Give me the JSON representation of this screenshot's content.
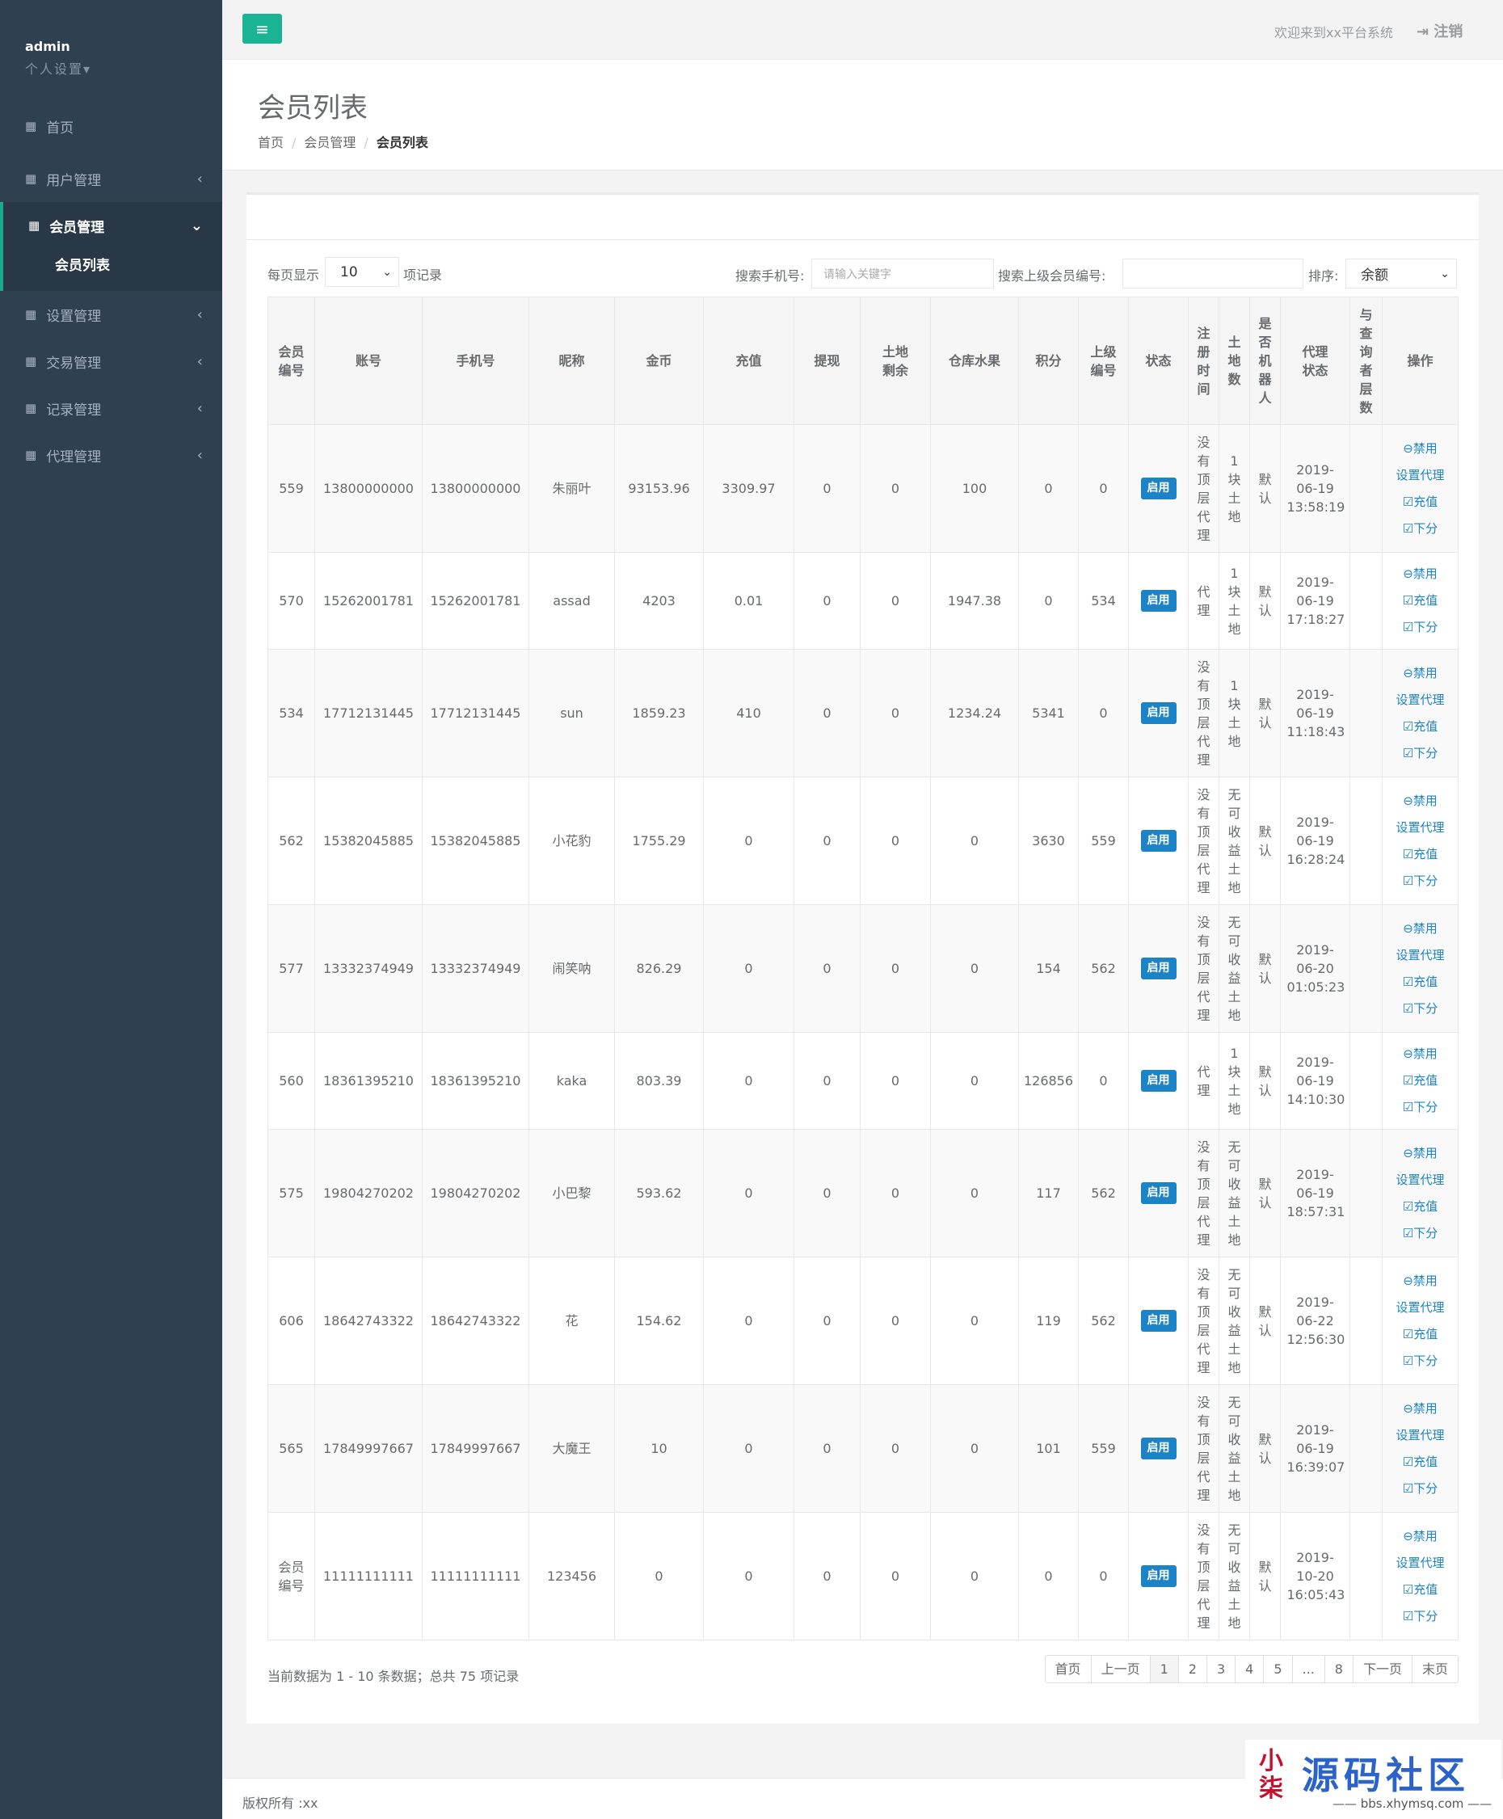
{
  "sidebar": {
    "username": "admin",
    "settings": "个人设置▾",
    "menu": [
      {
        "label": "首页",
        "arrow": ""
      },
      {
        "label": "用户管理",
        "arrow": "‹"
      },
      {
        "label": "会员管理",
        "arrow": "⌄",
        "active": true
      },
      {
        "label": "设置管理",
        "arrow": "‹"
      },
      {
        "label": "交易管理",
        "arrow": "‹"
      },
      {
        "label": "记录管理",
        "arrow": "‹"
      },
      {
        "label": "代理管理",
        "arrow": "‹"
      }
    ],
    "sub_item": "会员列表"
  },
  "topbar": {
    "menu_icon": "≡",
    "welcome": "欢迎来到xx平台系统",
    "logout": "注销"
  },
  "page": {
    "title": "会员列表",
    "breadcrumb": [
      "首页",
      "会员管理",
      "会员列表"
    ]
  },
  "controls": {
    "per_page_label": "每页显示",
    "per_page_value": "10",
    "records_label": "项记录",
    "search_phone_label": "搜索手机号:",
    "search_phone_placeholder": "请输入关键字",
    "search_parent_label": "搜索上级会员编号:",
    "sort_label": "排序:",
    "sort_value": "余额"
  },
  "table": {
    "headers": [
      "会员编号",
      "账号",
      "手机号",
      "昵称",
      "金币",
      "充值",
      "提现",
      "土地剩余",
      "仓库水果",
      "积分",
      "上级编号",
      "状态",
      "注册时间",
      "土地数",
      "是否机器人",
      "代理状态",
      "与查询者层数",
      "操作"
    ],
    "status_label": "启用",
    "op_disable": "⊖禁用",
    "op_agent": "设置代理",
    "op_recharge": "☑充值",
    "op_withdraw": "☑下分",
    "rows": [
      {
        "id": "559",
        "account": "13800000000",
        "phone": "13800000000",
        "nick": "朱丽叶",
        "gold": "93153.96",
        "recharge": "3309.97",
        "withdraw": "0",
        "land_left": "0",
        "fruit": "100",
        "points": "0",
        "parent": "0",
        "c13": "没有顶层代理",
        "c14": "1块土地",
        "c15": "默认",
        "c16": "2019-06-19 13:58:19",
        "c17": "",
        "agent_btn": true
      },
      {
        "id": "570",
        "account": "15262001781",
        "phone": "15262001781",
        "nick": "assad",
        "gold": "4203",
        "recharge": "0.01",
        "withdraw": "0",
        "land_left": "0",
        "fruit": "1947.38",
        "points": "0",
        "parent": "534",
        "c13": "代理",
        "c14": "1块土地",
        "c15": "默认",
        "c16": "2019-06-19 17:18:27",
        "c17": "",
        "agent_btn": false
      },
      {
        "id": "534",
        "account": "17712131445",
        "phone": "17712131445",
        "nick": "sun",
        "gold": "1859.23",
        "recharge": "410",
        "withdraw": "0",
        "land_left": "0",
        "fruit": "1234.24",
        "points": "5341",
        "parent": "0",
        "c13": "没有顶层代理",
        "c14": "1块土地",
        "c15": "默认",
        "c16": "2019-06-19 11:18:43",
        "c17": "",
        "agent_btn": true
      },
      {
        "id": "562",
        "account": "15382045885",
        "phone": "15382045885",
        "nick": "小花豹",
        "gold": "1755.29",
        "recharge": "0",
        "withdraw": "0",
        "land_left": "0",
        "fruit": "0",
        "points": "3630",
        "parent": "559",
        "c13": "没有顶层代理",
        "c14": "无可收益土地",
        "c15": "默认",
        "c16": "2019-06-19 16:28:24",
        "c17": "",
        "agent_btn": true
      },
      {
        "id": "577",
        "account": "13332374949",
        "phone": "13332374949",
        "nick": "闹笑呐",
        "gold": "826.29",
        "recharge": "0",
        "withdraw": "0",
        "land_left": "0",
        "fruit": "0",
        "points": "154",
        "parent": "562",
        "c13": "没有顶层代理",
        "c14": "无可收益土地",
        "c15": "默认",
        "c16": "2019-06-20 01:05:23",
        "c17": "",
        "agent_btn": true
      },
      {
        "id": "560",
        "account": "18361395210",
        "phone": "18361395210",
        "nick": "kaka",
        "gold": "803.39",
        "recharge": "0",
        "withdraw": "0",
        "land_left": "0",
        "fruit": "0",
        "points": "126856",
        "parent": "0",
        "c13": "代理",
        "c14": "1块土地",
        "c15": "默认",
        "c16": "2019-06-19 14:10:30",
        "c17": "",
        "agent_btn": false
      },
      {
        "id": "575",
        "account": "19804270202",
        "phone": "19804270202",
        "nick": "小巴黎",
        "gold": "593.62",
        "recharge": "0",
        "withdraw": "0",
        "land_left": "0",
        "fruit": "0",
        "points": "117",
        "parent": "562",
        "c13": "没有顶层代理",
        "c14": "无可收益土地",
        "c15": "默认",
        "c16": "2019-06-19 18:57:31",
        "c17": "",
        "agent_btn": true
      },
      {
        "id": "606",
        "account": "18642743322",
        "phone": "18642743322",
        "nick": "花",
        "gold": "154.62",
        "recharge": "0",
        "withdraw": "0",
        "land_left": "0",
        "fruit": "0",
        "points": "119",
        "parent": "562",
        "c13": "没有顶层代理",
        "c14": "无可收益土地",
        "c15": "默认",
        "c16": "2019-06-22 12:56:30",
        "c17": "",
        "agent_btn": true
      },
      {
        "id": "565",
        "account": "17849997667",
        "phone": "17849997667",
        "nick": "大魔王",
        "gold": "10",
        "recharge": "0",
        "withdraw": "0",
        "land_left": "0",
        "fruit": "0",
        "points": "101",
        "parent": "559",
        "c13": "没有顶层代理",
        "c14": "无可收益土地",
        "c15": "默认",
        "c16": "2019-06-19 16:39:07",
        "c17": "",
        "agent_btn": true
      },
      {
        "id": "会员编号",
        "account": "11111111111",
        "phone": "11111111111",
        "nick": "123456",
        "gold": "0",
        "recharge": "0",
        "withdraw": "0",
        "land_left": "0",
        "fruit": "0",
        "points": "0",
        "parent": "0",
        "c13": "没有顶层代理",
        "c14": "无可收益土地",
        "c15": "默认",
        "c16": "2019-10-20 16:05:43",
        "c17": "",
        "agent_btn": true
      }
    ]
  },
  "footer_info": "当前数据为 1 - 10 条数据；总共 75 项记录",
  "pagination": [
    "首页",
    "上一页",
    "1",
    "2",
    "3",
    "4",
    "5",
    "...",
    "8",
    "下一页",
    "末页"
  ],
  "page_footer": "版权所有 :xx",
  "watermark": {
    "seal": "小柒",
    "title": "源码社区",
    "url": "—— bbs.xhymsq.com ——"
  }
}
